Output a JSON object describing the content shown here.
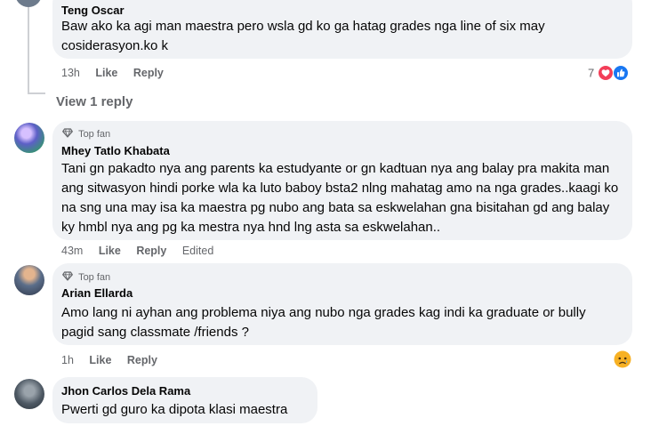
{
  "comments": [
    {
      "author": "Teng Oscar",
      "text": "Baw ako ka agi man maestra pero wsla gd ko ga hatag grades nga line of six may cosiderasyon.ko k",
      "time": "13h",
      "like": "Like",
      "reply": "Reply",
      "reaction_count": "7"
    },
    {
      "badge": "Top fan",
      "author": "Mhey Tatlo Khabata",
      "text": "Tani gn pakadto nya ang parents ka estudyante or gn kadtuan nya ang balay pra makita man ang sitwasyon hindi porke wla ka luto baboy bsta2 nlng mahatag amo na nga grades..kaagi ko na sng una may isa ka maestra pg nubo ang bata sa eskwelahan gna bisitahan gd ang balay ky hmbl nya ang pg ka mestra nya hnd lng asta sa eskwelahan..",
      "time": "43m",
      "like": "Like",
      "reply": "Reply",
      "edited": "Edited"
    },
    {
      "badge": "Top fan",
      "author": "Arian Ellarda",
      "text": "Amo lang ni ayhan ang problema niya ang nubo nga grades kag indi ka graduate or bully pagid sang classmate /friends ?",
      "time": "1h",
      "like": "Like",
      "reply": "Reply"
    },
    {
      "author": "Jhon Carlos Dela Rama",
      "text": "Pwerti gd guro ka dipota klasi maestra"
    }
  ],
  "view_replies": "View 1 reply",
  "colors": {
    "bubble": "#f0f2f5",
    "secondary_text": "#65676b",
    "love": "#f33e58",
    "like_blue": "#1877f2",
    "sad_yellow": "#f7b125"
  }
}
